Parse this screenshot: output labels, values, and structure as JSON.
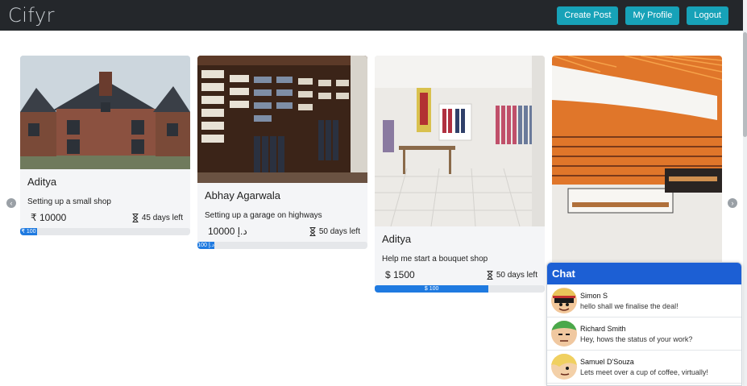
{
  "nav": {
    "brand": "Cifyr",
    "buttons": [
      "Create Post",
      "My Profile",
      "Logout"
    ]
  },
  "carousel": {
    "cards": [
      {
        "owner": "Aditya",
        "description": "Setting up a small shop",
        "amount": "₹ 10000",
        "days_left": "45 days left",
        "progress_label": "₹ 100",
        "progress_fraction": 0.1,
        "image": "brick-house-photo"
      },
      {
        "owner": "Abhay Agarwala",
        "description": "Setting up a garage on highways",
        "amount": "د.إ 10000",
        "days_left": "50 days left",
        "progress_label": "د.إ 100",
        "progress_fraction": 0.1,
        "image": "clothing-shelves-photo"
      },
      {
        "owner": "Aditya",
        "description": "Help me start a bouquet shop",
        "amount": "$ 1500",
        "days_left": "50 days left",
        "progress_label": "$ 100",
        "progress_fraction": 0.67,
        "image": "boutique-interior-photo"
      },
      {
        "owner": "",
        "description": "",
        "amount": "",
        "days_left": "",
        "progress_label": "",
        "progress_fraction": 0,
        "image": "bakery-counter-photo"
      }
    ],
    "dots": 6,
    "active_dot": 0
  },
  "chat": {
    "title": "Chat",
    "conversations": [
      {
        "name": "Simon S",
        "message": "hello shall we finalise the deal!",
        "avatar": "straw-hat-avatar"
      },
      {
        "name": "Richard Smith",
        "message": "Hey, hows the status of your work?",
        "avatar": "green-hair-avatar"
      },
      {
        "name": "Samuel D'Souza",
        "message": "Lets meet over a cup of coffee, virtually!",
        "avatar": "blonde-avatar"
      }
    ]
  },
  "colors": {
    "navbar": "#24272b",
    "accent": "#17a2b8",
    "progress": "#1f7ae0",
    "chat_header": "#1c5fd4"
  }
}
